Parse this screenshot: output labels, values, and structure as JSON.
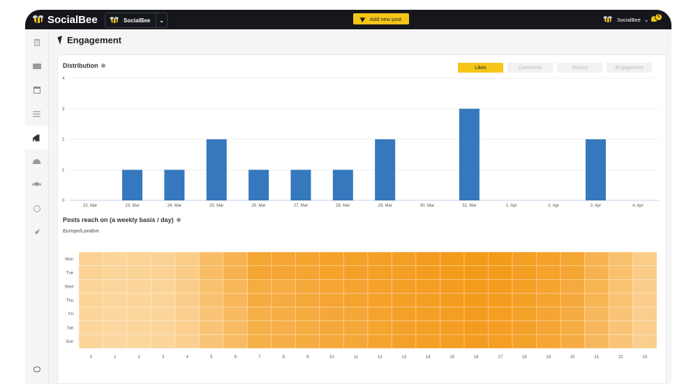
{
  "topbar": {
    "logo_text": "SocialBee",
    "workspace_name": "SocialBee",
    "add_post_label": "Add new post",
    "user_name": "SocialBee",
    "notification_count": "5"
  },
  "page": {
    "title": "Engagement"
  },
  "distribution": {
    "title": "Distribution",
    "tabs": [
      {
        "label": "Likes",
        "active": true
      },
      {
        "label": "Comments",
        "active": false
      },
      {
        "label": "Shares",
        "active": false
      },
      {
        "label": "Engagement",
        "active": false
      }
    ]
  },
  "heatmap_section": {
    "title": "Posts reach on (a weekly basis / day)",
    "timezone": "Europe/London"
  },
  "chart_data": [
    {
      "type": "bar",
      "categories": [
        "22. Mar",
        "23. Mar",
        "24. Mar",
        "25. Mar",
        "26. Mar",
        "27. Mar",
        "28. Mar",
        "29. Mar",
        "30. Mar",
        "31. Mar",
        "1. Apr",
        "2. Apr",
        "3. Apr",
        "4. Apr"
      ],
      "values": [
        0,
        1,
        1,
        2,
        1,
        1,
        1,
        2,
        0,
        3,
        0,
        0,
        2,
        0
      ],
      "ylim": [
        0,
        4
      ],
      "yticks": [
        0,
        1,
        2,
        3,
        4
      ],
      "grid": true,
      "color": "#3578bd"
    },
    {
      "type": "heatmap",
      "rows": [
        "Mon",
        "Tue",
        "Wed",
        "Thu",
        "Fri",
        "Sat",
        "Sun"
      ],
      "columns": [
        "0",
        "1",
        "2",
        "3",
        "4",
        "5",
        "6",
        "7",
        "8",
        "9",
        "10",
        "11",
        "12",
        "13",
        "14",
        "15",
        "16",
        "17",
        "18",
        "19",
        "20",
        "21",
        "22",
        "23"
      ],
      "values": [
        [
          0.22,
          0.18,
          0.2,
          0.22,
          0.3,
          0.5,
          0.62,
          0.8,
          0.8,
          0.82,
          0.85,
          0.86,
          0.88,
          0.9,
          0.92,
          0.94,
          0.95,
          0.94,
          0.9,
          0.85,
          0.8,
          0.62,
          0.45,
          0.3
        ],
        [
          0.22,
          0.18,
          0.2,
          0.22,
          0.3,
          0.5,
          0.62,
          0.8,
          0.8,
          0.82,
          0.85,
          0.86,
          0.88,
          0.9,
          0.92,
          0.94,
          0.95,
          0.94,
          0.9,
          0.85,
          0.8,
          0.62,
          0.45,
          0.3
        ],
        [
          0.2,
          0.16,
          0.18,
          0.2,
          0.28,
          0.45,
          0.58,
          0.72,
          0.72,
          0.76,
          0.8,
          0.82,
          0.85,
          0.88,
          0.9,
          0.92,
          0.94,
          0.92,
          0.88,
          0.82,
          0.75,
          0.6,
          0.42,
          0.28
        ],
        [
          0.2,
          0.16,
          0.18,
          0.2,
          0.28,
          0.45,
          0.58,
          0.72,
          0.72,
          0.76,
          0.8,
          0.82,
          0.85,
          0.88,
          0.9,
          0.92,
          0.94,
          0.92,
          0.88,
          0.82,
          0.75,
          0.6,
          0.42,
          0.28
        ],
        [
          0.18,
          0.15,
          0.16,
          0.18,
          0.25,
          0.4,
          0.52,
          0.66,
          0.68,
          0.72,
          0.76,
          0.78,
          0.82,
          0.86,
          0.88,
          0.9,
          0.92,
          0.9,
          0.86,
          0.8,
          0.72,
          0.56,
          0.4,
          0.26
        ],
        [
          0.18,
          0.15,
          0.16,
          0.18,
          0.25,
          0.4,
          0.52,
          0.66,
          0.68,
          0.72,
          0.76,
          0.78,
          0.82,
          0.86,
          0.88,
          0.9,
          0.92,
          0.9,
          0.86,
          0.8,
          0.72,
          0.56,
          0.4,
          0.26
        ],
        [
          0.18,
          0.15,
          0.16,
          0.18,
          0.25,
          0.4,
          0.52,
          0.66,
          0.68,
          0.72,
          0.76,
          0.78,
          0.82,
          0.86,
          0.88,
          0.9,
          0.92,
          0.9,
          0.86,
          0.8,
          0.72,
          0.56,
          0.4,
          0.26
        ]
      ],
      "low_color": "#fde3b8",
      "high_color": "#f39612"
    }
  ]
}
